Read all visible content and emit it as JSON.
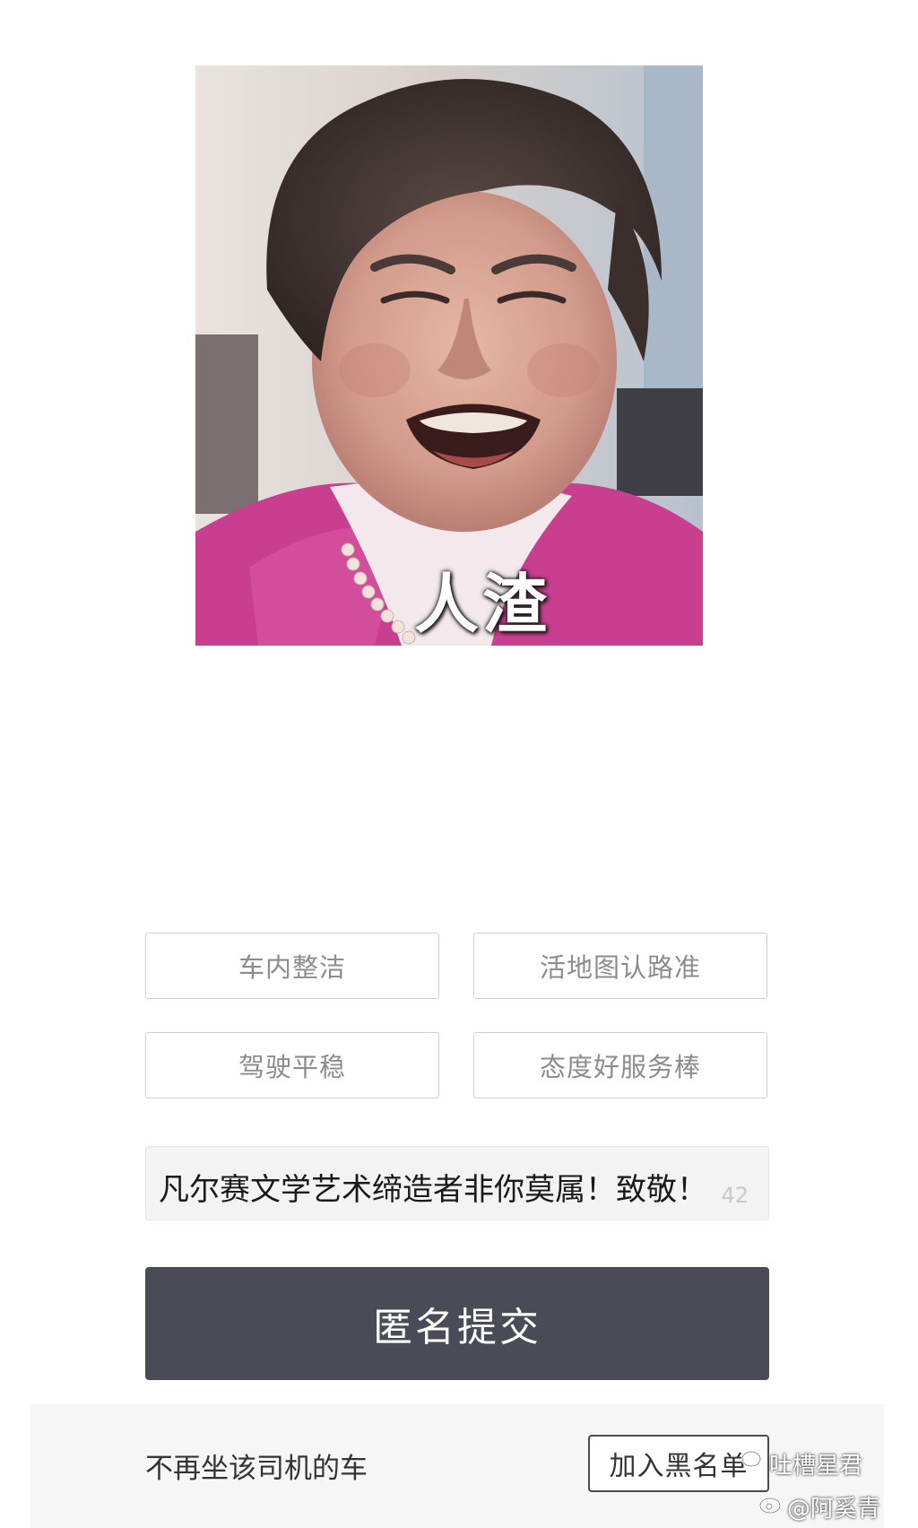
{
  "meme": {
    "caption": "人渣",
    "icon": "angry-woman-meme-image"
  },
  "tags": [
    {
      "label": "车内整洁"
    },
    {
      "label": "活地图认路准"
    },
    {
      "label": "驾驶平稳"
    },
    {
      "label": "态度好服务棒"
    }
  ],
  "comment": {
    "value": "凡尔赛文学艺术缔造者非你莫属！致敬！",
    "count": "42"
  },
  "submit": {
    "label": "匿名提交"
  },
  "blacklist": {
    "label": "不再坐该司机的车",
    "button": "加入黑名单"
  },
  "watermarks": {
    "wechat": "吐槽星君",
    "weibo": "@阿奚青"
  },
  "colors": {
    "submit_bg": "#4a4b57",
    "tag_border": "#cfcfcf",
    "tag_text": "#8c8c8c"
  }
}
